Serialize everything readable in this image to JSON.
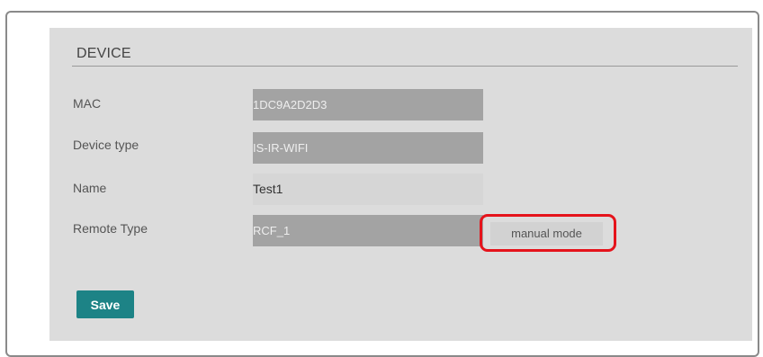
{
  "section": {
    "title": "DEVICE"
  },
  "fields": {
    "mac": {
      "label": "MAC",
      "value": "1DC9A2D2D3"
    },
    "device_type": {
      "label": "Device type",
      "value": "IS-IR-WIFI"
    },
    "name": {
      "label": "Name",
      "value": "Test1"
    },
    "remote_type": {
      "label": "Remote Type",
      "value": "RCF_1"
    }
  },
  "buttons": {
    "manual_mode": "manual mode",
    "save": "Save"
  },
  "colors": {
    "panel_bg": "#dcdcdc",
    "readonly_field_bg": "#a3a3a3",
    "save_button_bg": "#1d8386",
    "highlight_outline": "#e5131b"
  }
}
